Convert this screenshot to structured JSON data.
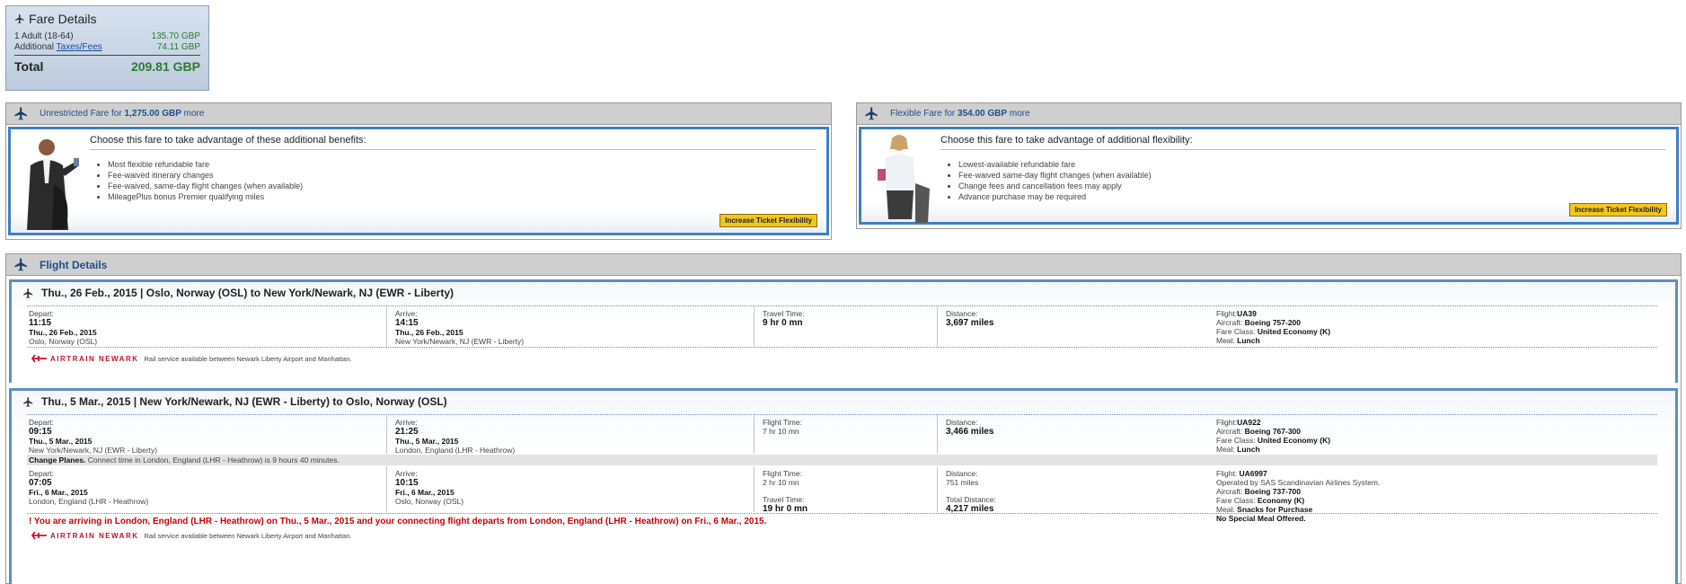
{
  "fare_details": {
    "title": "Fare Details",
    "adult_label": "1 Adult (18-64)",
    "adult_amount": "135.70 GBP",
    "additional_label": "Additional",
    "taxes_link": "Taxes/Fees",
    "taxes_amount": "74.11 GBP",
    "total_label": "Total",
    "total_amount": "209.81 GBP"
  },
  "upsells": [
    {
      "head_prefix": "Unrestricted Fare for",
      "head_amount": "1,275.00 GBP",
      "head_suffix": "more",
      "choose": "Choose this fare to take advantage of these additional benefits:",
      "benefits": [
        "Most flexible refundable fare",
        "Fee-waived itinerary changes",
        "Fee-waived, same-day flight changes (when available)",
        "MileagePlus bonus Premier qualifying miles"
      ],
      "button": "Increase Ticket Flexibility"
    },
    {
      "head_prefix": "Flexible Fare for",
      "head_amount": "354.00 GBP",
      "head_suffix": "more",
      "choose": "Choose this fare to take advantage of additional flexibility:",
      "benefits": [
        "Lowest-available refundable fare",
        "Fee-waived same-day flight changes (when available)",
        "Change fees and cancellation fees may apply",
        "Advance purchase may be required"
      ],
      "button": "Increase Ticket Flexibility"
    }
  ],
  "flight_details": {
    "title": "Flight Details",
    "airtrain_logo": "AIRTRAIN NEWARK",
    "airtrain_note": "Rail service available between Newark Liberty Airport and Manhattan.",
    "segments": [
      {
        "title": "Thu., 26 Feb., 2015 | Oslo, Norway (OSL) to New York/Newark, NJ (EWR - Liberty)",
        "legs": [
          {
            "depart_label": "Depart:",
            "depart_time": "11:15",
            "depart_date": "Thu., 26 Feb., 2015",
            "depart_place": "Oslo, Norway (OSL)",
            "arrive_label": "Arrive:",
            "arrive_time": "14:15",
            "arrive_date": "Thu., 26 Feb., 2015",
            "arrive_place": "New York/Newark, NJ (EWR - Liberty)",
            "time_label": "Travel Time:",
            "time_value": "9 hr 0 mn",
            "distance_label": "Distance:",
            "distance_value": "3,697 miles",
            "flight_label": "Flight:",
            "flight_value": "UA39",
            "aircraft_label": "Aircraft:",
            "aircraft_value": "Boeing 757-200",
            "fare_class_label": "Fare Class:",
            "fare_class_value": "United Economy (K)",
            "meal_label": "Meal:",
            "meal_value": "Lunch"
          }
        ]
      },
      {
        "title": "Thu., 5 Mar., 2015 | New York/Newark, NJ (EWR - Liberty) to Oslo, Norway (OSL)",
        "legs": [
          {
            "depart_label": "Depart:",
            "depart_time": "09:15",
            "depart_date": "Thu., 5 Mar., 2015",
            "depart_place": "New York/Newark, NJ (EWR - Liberty)",
            "arrive_label": "Arrive:",
            "arrive_time": "21:25",
            "arrive_date": "Thu., 5 Mar., 2015",
            "arrive_place": "London, England (LHR - Heathrow)",
            "time_label": "Flight Time:",
            "time_value": "7 hr 10 mn",
            "distance_label": "Distance:",
            "distance_value": "3,466 miles",
            "flight_label": "Flight:",
            "flight_value": "UA922",
            "aircraft_label": "Aircraft:",
            "aircraft_value": "Boeing 767-300",
            "fare_class_label": "Fare Class:",
            "fare_class_value": "United Economy (K)",
            "meal_label": "Meal:",
            "meal_value": "Lunch"
          },
          {
            "depart_label": "Depart:",
            "depart_time": "07:05",
            "depart_date": "Fri., 6 Mar., 2015",
            "depart_place": "London, England (LHR - Heathrow)",
            "arrive_label": "Arrive:",
            "arrive_time": "10:15",
            "arrive_date": "Fri., 6 Mar., 2015",
            "arrive_place": "Oslo, Norway (OSL)",
            "time_label": "Flight Time:",
            "time_value": "2 hr 10 mn",
            "travel_label": "Travel Time:",
            "travel_value": "19 hr 0 mn",
            "distance_label": "Distance:",
            "distance_value": "751 miles",
            "total_distance_label": "Total Distance:",
            "total_distance_value": "4,217 miles",
            "flight_label": "Flight:",
            "flight_value": "UA6997",
            "operated_by": "Operated by SAS Scandinavian Airlines System.",
            "aircraft_label": "Aircraft:",
            "aircraft_value": "Boeing 737-700",
            "fare_class_label": "Fare Class:",
            "fare_class_value": "Economy (K)",
            "meal_label": "Meal:",
            "meal_value": "Snacks for Purchase",
            "meal_note": "No Special Meal Offered."
          }
        ],
        "change_planes_label": "Change Planes.",
        "change_planes_text": "Connect time in London, England (LHR - Heathrow) is 9 hours 40 minutes.",
        "warning": "! You are arriving in London, England (LHR - Heathrow) on Thu., 5 Mar., 2015 and your connecting flight departs from London, England (LHR - Heathrow) on Fri., 6 Mar., 2015."
      }
    ]
  },
  "colors": {
    "header_gray": "#cfcfcf",
    "link_blue": "#1f4d8c",
    "price_green": "#2a7d2a",
    "button_yellow": "#f2c61a",
    "warning_red": "#cc0000",
    "airtrain_red": "#c8102e"
  },
  "icons": {
    "plane": "airplane-icon",
    "airtrain": "airtrain-logo"
  }
}
